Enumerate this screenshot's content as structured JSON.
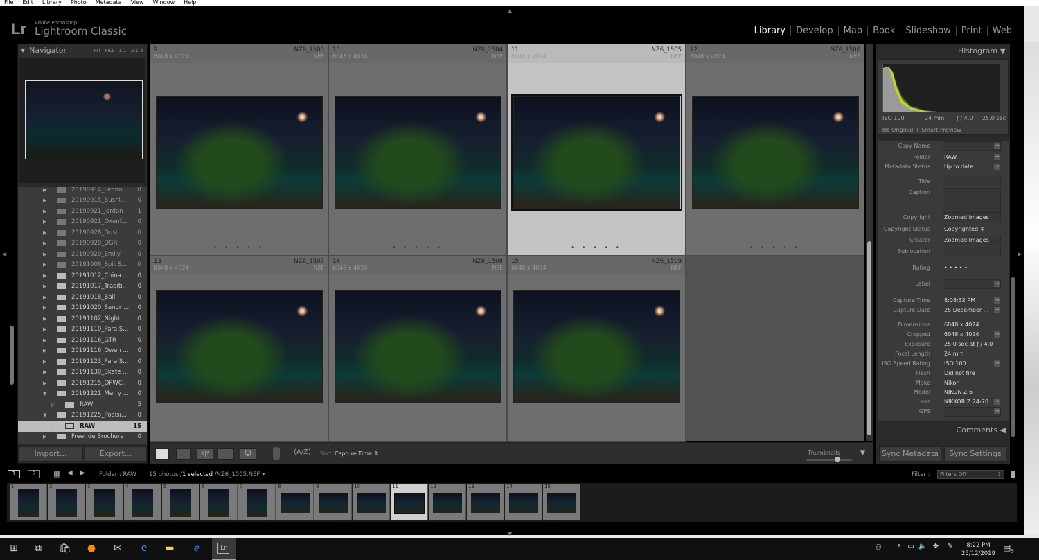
{
  "menu": [
    "File",
    "Edit",
    "Library",
    "Photo",
    "Metadata",
    "View",
    "Window",
    "Help"
  ],
  "app": {
    "logo": "Lr",
    "subtitle": "Adobe Photoshop",
    "title": "Lightroom Classic"
  },
  "modules": [
    "Library",
    "Develop",
    "Map",
    "Book",
    "Slideshow",
    "Print",
    "Web"
  ],
  "navigator": {
    "title": "Navigator",
    "zoom": [
      "FIT",
      "FILL",
      "1:1",
      "2:1"
    ]
  },
  "folders": [
    {
      "name": "20190914_Lenno...",
      "count": "0",
      "missing": true
    },
    {
      "name": "20190915_Bushl...",
      "count": "0",
      "missing": true
    },
    {
      "name": "20190921_Jordan",
      "count": "1",
      "missing": true
    },
    {
      "name": "20190921_Oxenf...",
      "count": "0",
      "missing": true
    },
    {
      "name": "20190928_Dust ...",
      "count": "0",
      "missing": true
    },
    {
      "name": "20190929_DGR",
      "count": "0",
      "missing": true
    },
    {
      "name": "20190929_Emily",
      "count": "0",
      "missing": true
    },
    {
      "name": "20191006_Spit S...",
      "count": "0",
      "missing": true
    },
    {
      "name": "20191012_China ...",
      "count": "0"
    },
    {
      "name": "20191017_Traditi...",
      "count": "0"
    },
    {
      "name": "20191018_Bali",
      "count": "0"
    },
    {
      "name": "20191020_Sanur ...",
      "count": "0"
    },
    {
      "name": "20191102_Night ...",
      "count": "0"
    },
    {
      "name": "20191110_Para S...",
      "count": "0"
    },
    {
      "name": "20191116_GTR",
      "count": "0"
    },
    {
      "name": "20191116_Owen ...",
      "count": "0"
    },
    {
      "name": "20191123_Para S...",
      "count": "0"
    },
    {
      "name": "20191130_Skate ...",
      "count": "0"
    },
    {
      "name": "20191215_QPWC...",
      "count": "0"
    },
    {
      "name": "20191221_Merry ...",
      "count": "0",
      "expanded": true
    },
    {
      "name": "RAW",
      "count": "5",
      "sub": true
    },
    {
      "name": "20191225_Poolsi...",
      "count": "0",
      "expanded": true
    },
    {
      "name": "RAW",
      "count": "15",
      "sub": true,
      "selected": true
    },
    {
      "name": "Freeride Brochure",
      "count": "0"
    }
  ],
  "left_buttons": {
    "import": "Import...",
    "export": "Export..."
  },
  "grid": [
    {
      "index": "9",
      "name": "NZ6_1503",
      "dims": "6048 x 4024",
      "ext": "NEF"
    },
    {
      "index": "10",
      "name": "NZ6_1504",
      "dims": "6048 x 4024",
      "ext": "NEF"
    },
    {
      "index": "11",
      "name": "NZ6_1505",
      "dims": "6048 x 4024",
      "ext": "NEF",
      "selected": true
    },
    {
      "index": "12",
      "name": "NZ6_1506",
      "dims": "6048 x 4024",
      "ext": "NEF"
    },
    {
      "index": "13",
      "name": "NZ6_1507",
      "dims": "6048 x 4024",
      "ext": "NEF"
    },
    {
      "index": "14",
      "name": "NZ6_1508",
      "dims": "6048 x 4024",
      "ext": "NEF"
    },
    {
      "index": "15",
      "name": "NZ6_1509",
      "dims": "6048 x 4024",
      "ext": "NEF"
    }
  ],
  "rating_dots": "• • • • •",
  "toolbar": {
    "sort_label": "Sort:",
    "sort_value": "Capture Time",
    "thumbnails_label": "Thumbnails",
    "thumbnail_size_pct": 70
  },
  "histogram": {
    "title": "Histogram",
    "iso": "ISO 100",
    "focal": "24 mm",
    "aperture": "ƒ / 4.0",
    "shutter": "25.0 sec",
    "preview": "Original + Smart Preview"
  },
  "metadata": [
    {
      "k": "Copy Name",
      "v": "",
      "box": true,
      "arrow": true
    },
    {
      "k": "Folder",
      "v": "RAW",
      "arrow": true
    },
    {
      "k": "Metadata Status",
      "v": "Up to date",
      "arrow": true
    },
    {
      "k": "Title",
      "v": "",
      "box": true
    },
    {
      "k": "Caption",
      "v": "",
      "box": true
    },
    {
      "k": "Copyright",
      "v": "Zoomed Images",
      "box": true
    },
    {
      "k": "Copyright Status",
      "v": "Copyrighted ⇕"
    },
    {
      "k": "Creator",
      "v": "Zoomed Images",
      "box": true
    },
    {
      "k": "Sublocation",
      "v": "",
      "box": true
    },
    {
      "k": "Rating",
      "v": "• • • • •"
    },
    {
      "k": "Label",
      "v": "",
      "box": true,
      "arrow": true
    },
    {
      "k": "Capture Time",
      "v": "8:08:32 PM",
      "arrow": true
    },
    {
      "k": "Capture Date",
      "v": "25 December ...",
      "arrow": true
    },
    {
      "k": "Dimensions",
      "v": "6048 x 4024"
    },
    {
      "k": "Cropped",
      "v": "6048 x 4024",
      "arrow": true
    },
    {
      "k": "Exposure",
      "v": "25.0 sec at ƒ / 4.0"
    },
    {
      "k": "Focal Length",
      "v": "24 mm"
    },
    {
      "k": "ISO Speed Rating",
      "v": "ISO 100",
      "arrow": true
    },
    {
      "k": "Flash",
      "v": "Did not fire"
    },
    {
      "k": "Make",
      "v": "Nikon"
    },
    {
      "k": "Model",
      "v": "NIKON Z 6"
    },
    {
      "k": "Lens",
      "v": "NIKKOR Z 24-70",
      "arrow": true
    },
    {
      "k": "GPS",
      "v": "",
      "box": true,
      "arrow": true
    }
  ],
  "comments": "Comments",
  "right_buttons": {
    "sync_metadata": "Sync Metadata",
    "sync_settings": "Sync Settings"
  },
  "filmbar": {
    "screen1": "1",
    "screen2": "2",
    "folder": "Folder : RAW",
    "count": "15 photos /",
    "selected": "1 selected",
    "file": "/NZ6_1505.NEF",
    "filter_label": "Filter :",
    "filter_value": "Filters Off"
  },
  "filmstrip": [
    "1",
    "2",
    "3",
    "4",
    "5",
    "6",
    "7",
    "8",
    "9",
    "10",
    "11",
    "12",
    "13",
    "14",
    "15"
  ],
  "filmstrip_selected": "11",
  "taskbar": {
    "time": "8:22 PM",
    "date": "25/12/2019",
    "notifications": "5"
  }
}
